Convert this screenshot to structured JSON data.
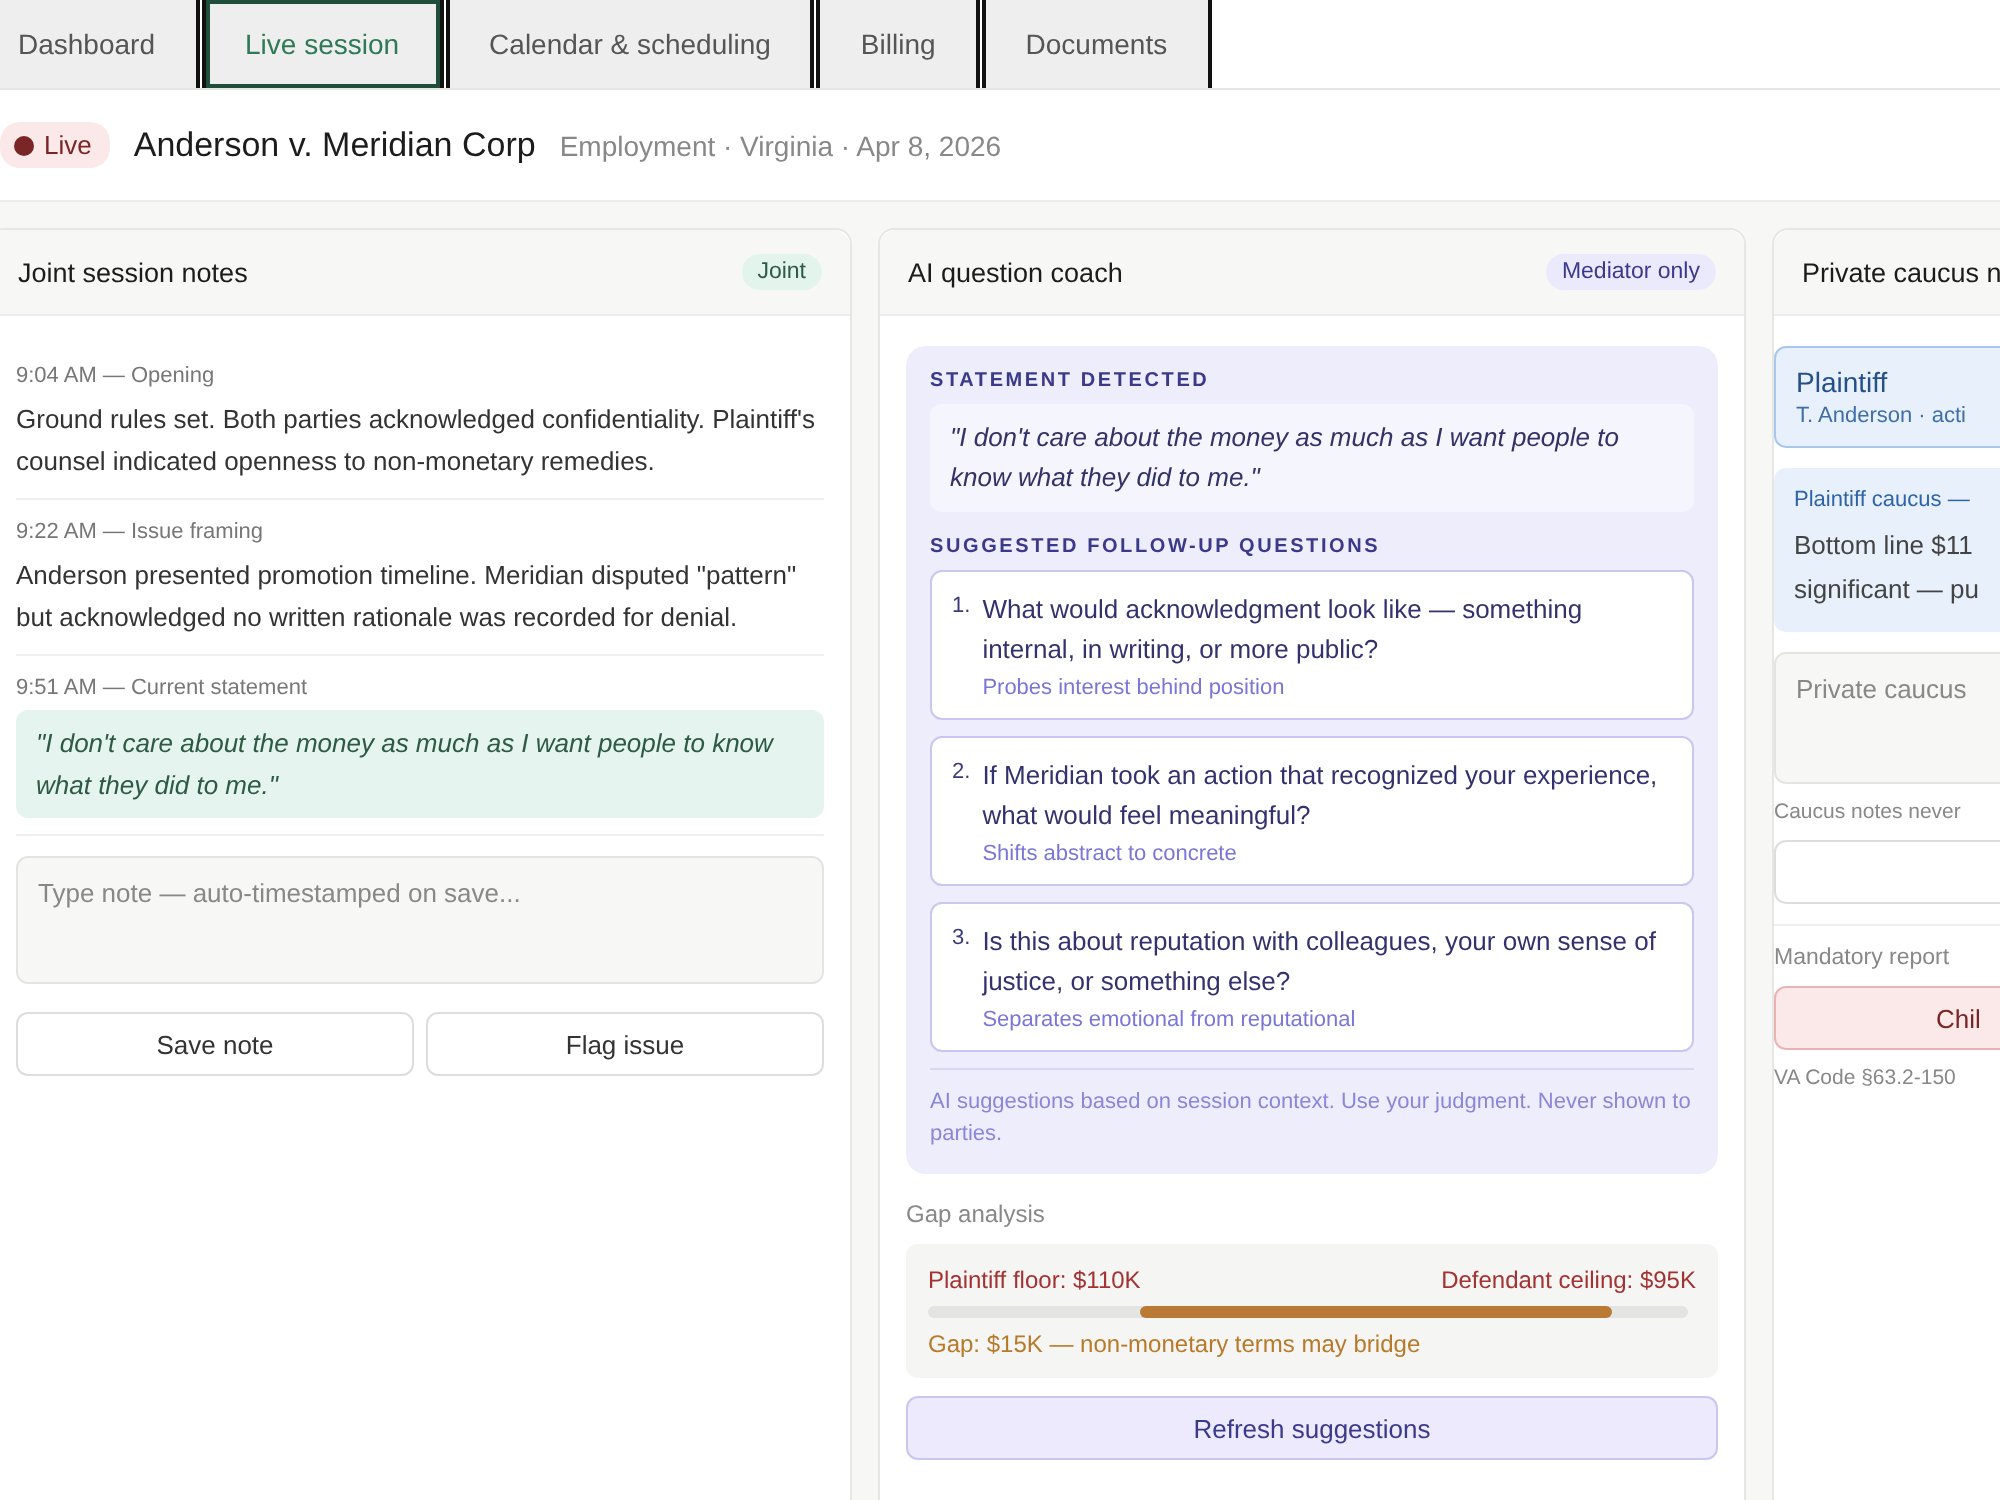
{
  "tabs": [
    {
      "label": "Dashboard",
      "selected": false
    },
    {
      "label": "Live session",
      "selected": true
    },
    {
      "label": "Calendar & scheduling",
      "selected": false
    },
    {
      "label": "Billing",
      "selected": false
    },
    {
      "label": "Documents",
      "selected": false
    }
  ],
  "session": {
    "status": "Live",
    "title": "Anderson v. Meridian Corp",
    "meta": "Employment · Virginia · Apr 8, 2026"
  },
  "joint_notes": {
    "title": "Joint session notes",
    "badge": "Joint",
    "notes": [
      {
        "time": "9:04 AM — Opening",
        "text": "Ground rules set. Both parties acknowledged confidentiality. Plaintiff's counsel indicated openness to non-monetary remedies.",
        "kind": "note"
      },
      {
        "time": "9:22 AM — Issue framing",
        "text": "Anderson presented promotion timeline. Meridian disputed \"pattern\" but acknowledged no written rationale was recorded for denial.",
        "kind": "note"
      },
      {
        "time": "9:51 AM — Current statement",
        "text": "\"I don't care about the money as much as I want people to know what they did to me.\"",
        "kind": "quote"
      }
    ],
    "note_field": {
      "placeholder": "Type note — auto-timestamped on save..."
    },
    "buttons": [
      "Save note",
      "Flag issue"
    ]
  },
  "coach": {
    "title": "AI question coach",
    "badge": "Mediator only",
    "statement_label": "STATEMENT DETECTED",
    "statement": "\"I don't care about the money as much as I want people to know what they did to me.\"",
    "questions_label": "SUGGESTED FOLLOW-UP QUESTIONS",
    "questions": [
      {
        "number": "1.",
        "text": "What would acknowledgment look like — something internal, in writing, or more public?",
        "hint": "Probes interest behind position"
      },
      {
        "number": "2.",
        "text": "If Meridian took an action that recognized your experience, what would feel meaningful?",
        "hint": "Shifts abstract to concrete"
      },
      {
        "number": "3.",
        "text": "Is this about reputation with colleagues, your own sense of justice, or something else?",
        "hint": "Separates emotional from reputational"
      }
    ],
    "disclaimer": "AI suggestions based on session context. Use your judgment. Never shown to parties.",
    "gap": {
      "label": "Gap analysis",
      "plaintiff": "Plaintiff floor: $110K",
      "defendant": "Defendant ceiling: $95K",
      "summary": "Gap: $15K — non-monetary terms may bridge"
    },
    "refresh_button": "Refresh suggestions"
  },
  "caucus": {
    "title": "Private caucus n",
    "party": {
      "name": "Plaintiff",
      "detail": "T. Anderson · acti"
    },
    "entry": {
      "heading": "Plaintiff caucus —",
      "lines": [
        "Bottom line $11",
        "significant — pu"
      ]
    },
    "note_field": {
      "placeholder": "Private caucus"
    },
    "privacy_note": "Caucus notes never",
    "mandatory_label": "Mandatory report",
    "report_button": "Chil",
    "citation": "VA Code §63.2-150"
  }
}
